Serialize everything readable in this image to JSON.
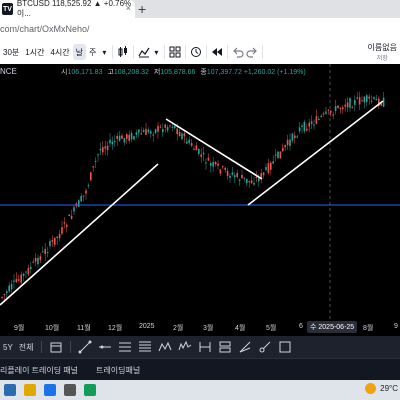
{
  "browser": {
    "tab_title": "BTCUSD 118,525.92 ▲ +0.76% 이...",
    "tab_close": "×",
    "new_tab": "+",
    "url": "com/chart/OxMxNeho/"
  },
  "toolbar": {
    "interval_30": "30분",
    "interval_1h": "1시간",
    "interval_4h": "4시간",
    "interval_day": "날",
    "interval_week": "주",
    "save_line1": "이름없음",
    "save_line2": "저장"
  },
  "chart": {
    "symbol": "NCE",
    "open_label": "시",
    "open": "106,171.83",
    "high_label": "고",
    "high": "108,208.32",
    "low_label": "저",
    "low": "105,878.66",
    "close_label": "종",
    "close": "107,397.72",
    "change": "+1,260.02 (+1.19%)",
    "colors": {
      "up": "#26a69a",
      "down": "#ef5350",
      "hline": "#2962ff",
      "trendline": "#ffffff"
    }
  },
  "time_axis": {
    "labels": [
      "9월",
      "10월",
      "11월",
      "12월",
      "2025",
      "2월",
      "3월",
      "4월",
      "5월",
      "6",
      "8월",
      "9"
    ],
    "cursor_label": "수 2025-06-25"
  },
  "range_bar": {
    "range_5y": "5Y",
    "all": "전체"
  },
  "bottom_panel": {
    "tab1": "리플레이 트레이딩 패널",
    "tab2": "트레이딩패널"
  },
  "taskbar": {
    "temperature": "29°C"
  }
}
